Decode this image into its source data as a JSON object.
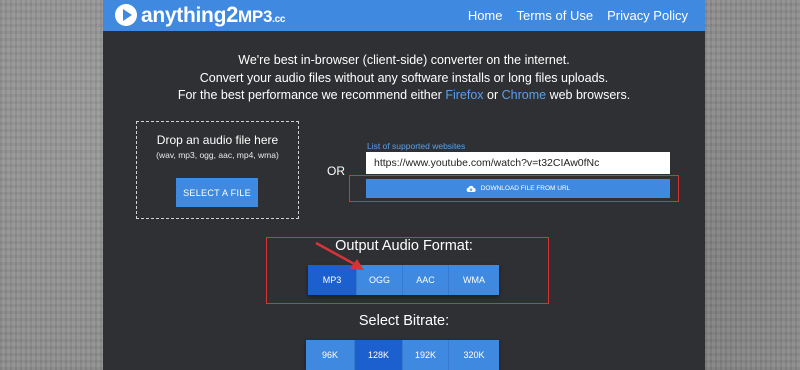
{
  "brand": {
    "logo_main": "anything",
    "logo_number": "2",
    "logo_mp3": "MP3",
    "logo_tld": ".cc"
  },
  "nav": {
    "items": [
      {
        "label": "Home"
      },
      {
        "label": "Terms of Use"
      },
      {
        "label": "Privacy Policy"
      }
    ]
  },
  "intro": {
    "line1": "We're best in-browser (client-side) converter on the internet.",
    "line2": "Convert your audio files without any software installs or long files uploads.",
    "line3_prefix": "For the best performance we recommend either",
    "firefox": "Firefox",
    "or_word": "or",
    "chrome": "Chrome",
    "line3_suffix": "web browsers."
  },
  "dropzone": {
    "title": "Drop an audio file here",
    "formats": "(wav, mp3, ogg, aac, mp4, wma)",
    "button": "SELECT A FILE"
  },
  "or_label": "OR",
  "url_section": {
    "list_link": "List of supported websites",
    "url_value": "https://www.youtube.com/watch?v=t32CIAw0fNc",
    "download_button": "DOWNLOAD FILE FROM URL"
  },
  "output_format": {
    "title": "Output Audio Format:",
    "options": [
      {
        "label": "MP3",
        "active": true
      },
      {
        "label": "OGG",
        "active": false
      },
      {
        "label": "AAC",
        "active": false
      },
      {
        "label": "WMA",
        "active": false
      }
    ]
  },
  "bitrate": {
    "title": "Select Bitrate:",
    "options": [
      {
        "label": "96K",
        "active": false
      },
      {
        "label": "128K",
        "active": true
      },
      {
        "label": "192K",
        "active": false
      },
      {
        "label": "320K",
        "active": false
      }
    ]
  },
  "icons": {
    "logo": "play-circle-icon",
    "download": "cloud-download-icon",
    "annotation": "red-arrow-icon"
  },
  "colors": {
    "accent": "#3f8ae0",
    "active": "#1c5fcf",
    "panel_bg": "#2e3033",
    "annotation_red": "#d9333a"
  }
}
